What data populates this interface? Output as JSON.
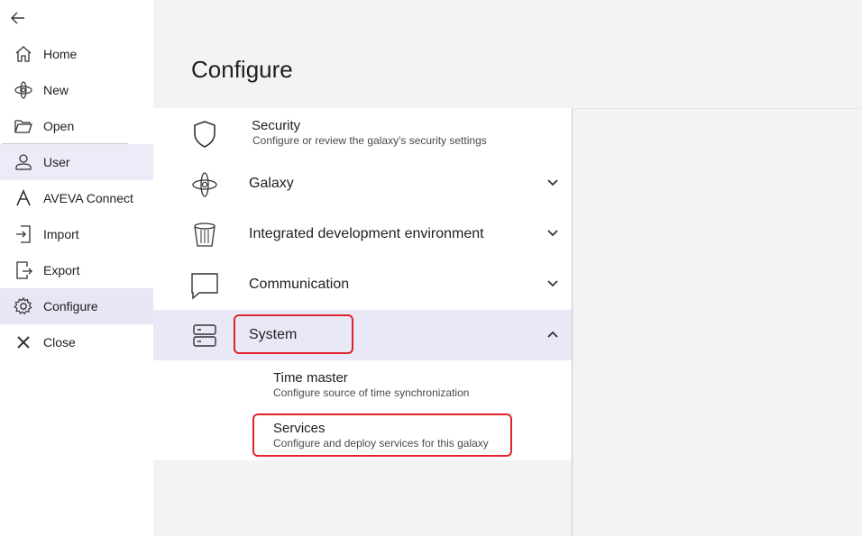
{
  "nav": {
    "back_icon": "arrow-left-icon",
    "items": [
      {
        "label": "Home",
        "icon": "home-icon"
      },
      {
        "label": "New",
        "icon": "galaxy-new-icon"
      },
      {
        "label": "Open",
        "icon": "folder-open-icon"
      },
      {
        "label": "User",
        "icon": "user-icon"
      },
      {
        "label": "AVEVA Connect",
        "icon": "aveva-connect-icon"
      },
      {
        "label": "Import",
        "icon": "import-icon"
      },
      {
        "label": "Export",
        "icon": "export-icon"
      },
      {
        "label": "Configure",
        "icon": "gear-icon"
      },
      {
        "label": "Close",
        "icon": "close-icon"
      }
    ],
    "active": "Configure"
  },
  "main": {
    "title": "Configure",
    "sections": [
      {
        "label": "Security",
        "description": "Configure or review the galaxy's security settings",
        "icon": "shield-icon"
      },
      {
        "label": "Galaxy",
        "icon": "galaxy-icon",
        "expanded": false
      },
      {
        "label": "Integrated development environment",
        "icon": "bucket-icon",
        "expanded": false
      },
      {
        "label": "Communication",
        "icon": "chat-icon",
        "expanded": false
      },
      {
        "label": "System",
        "icon": "server-icon",
        "expanded": true
      }
    ],
    "system_items": [
      {
        "label": "Time master",
        "description": "Configure source of time synchronization"
      },
      {
        "label": "Services",
        "description": "Configure and deploy services for this galaxy"
      }
    ]
  },
  "colors": {
    "accent_selected": "#e8e8f7",
    "highlight": "#e0242b"
  }
}
